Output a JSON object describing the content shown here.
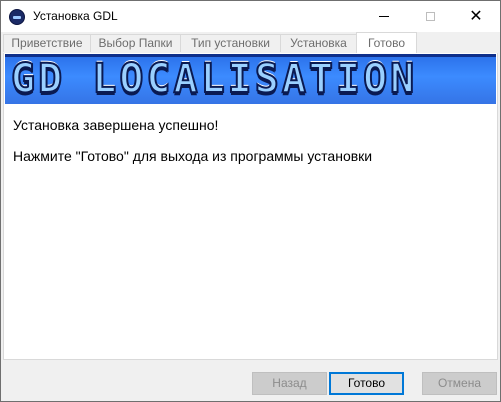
{
  "window": {
    "title": "Установка GDL"
  },
  "tabs": [
    {
      "label": "Приветствие",
      "active": false
    },
    {
      "label": "Выбор Папки",
      "active": false
    },
    {
      "label": "Тип установки",
      "active": false
    },
    {
      "label": "Установка",
      "active": false
    },
    {
      "label": "Готово",
      "active": true
    }
  ],
  "banner": {
    "text": "GD LOCALISATION"
  },
  "content": {
    "success_message": "Установка завершена успешно!",
    "instruction": "Нажмите \"Готово\" для выхода из программы установки"
  },
  "buttons": {
    "back": "Назад",
    "done": "Готово",
    "cancel": "Отмена"
  },
  "colors": {
    "accent": "#0078d7",
    "banner": "#3c8bff"
  }
}
